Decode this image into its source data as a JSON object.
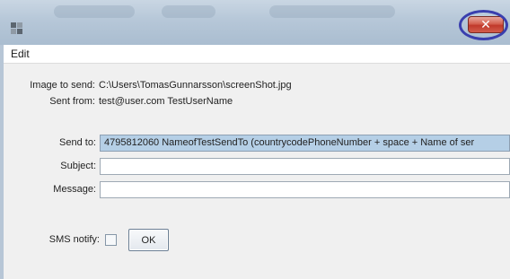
{
  "window": {
    "close_glyph": "✕",
    "colors": {
      "titlebar": "#b6c7d8",
      "close": "#c0392b",
      "highlight": "#3a3fae"
    }
  },
  "menu": {
    "edit": "Edit"
  },
  "info": {
    "image_label": "Image to send:",
    "image_value": "C:\\Users\\TomasGunnarsson\\screenShot.jpg",
    "from_label": "Sent from:",
    "from_value": "test@user.com TestUserName"
  },
  "form": {
    "send_to_label": "Send to:",
    "send_to_value": "4795812060 NameofTestSendTo (countrycodePhoneNumber + space + Name of ser",
    "subject_label": "Subject:",
    "subject_value": "",
    "message_label": "Message:",
    "message_value": "",
    "sms_label": "SMS notify:",
    "ok_label": "OK"
  },
  "icons": [
    "app-icon",
    "close-icon"
  ]
}
